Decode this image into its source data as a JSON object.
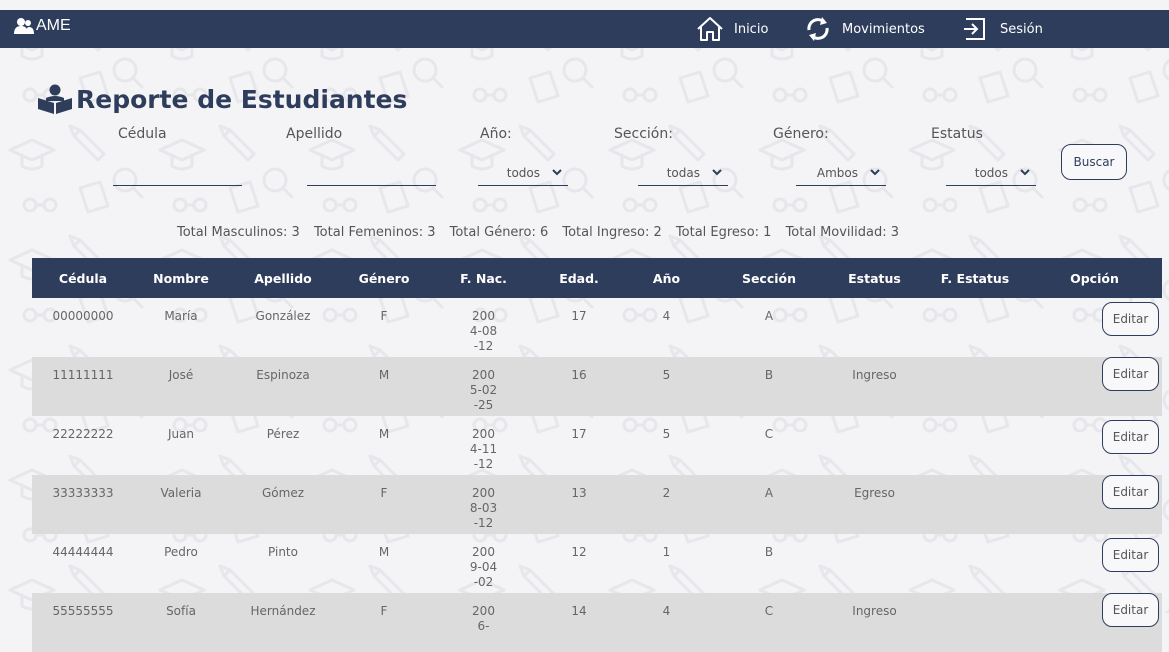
{
  "navbar": {
    "brand": "AME",
    "items": [
      {
        "label": "Inicio",
        "icon": "home-icon"
      },
      {
        "label": "Movimientos",
        "icon": "refresh-icon"
      },
      {
        "label": "Sesión",
        "icon": "logout-icon"
      }
    ]
  },
  "page": {
    "title": "Reporte de Estudiantes",
    "title_icon": "student-reading-icon"
  },
  "filters": {
    "cedula_label": "Cédula",
    "cedula_value": "",
    "apellido_label": "Apellido",
    "apellido_value": "",
    "anio_label": "Año:",
    "anio_value": "todos",
    "seccion_label": "Sección:",
    "seccion_value": "todas",
    "genero_label": "Género:",
    "genero_value": "Ambos",
    "estatus_label": "Estatus",
    "estatus_value": "todos",
    "buscar_label": "Buscar"
  },
  "totals": {
    "masculinos": "Total Masculinos: 3",
    "femeninos": "Total Femeninos: 3",
    "genero": "Total Género: 6",
    "ingreso": "Total Ingreso: 2",
    "egreso": "Total Egreso: 1",
    "movilidad": "Total Movilidad: 3"
  },
  "table": {
    "headers": [
      "Cédula",
      "Nombre",
      "Apellido",
      "Género",
      "F. Nac.",
      "Edad.",
      "Año",
      "Sección",
      "Estatus",
      "F. Estatus",
      "Opción"
    ],
    "edit_label": "Editar",
    "rows": [
      {
        "cedula": "00000000",
        "nombre": "María",
        "apellido": "González",
        "genero": "F",
        "fnac": "2004-08-12",
        "edad": "17",
        "anio": "4",
        "seccion": "A",
        "estatus": "",
        "festatus": ""
      },
      {
        "cedula": "11111111",
        "nombre": "José",
        "apellido": "Espinoza",
        "genero": "M",
        "fnac": "2005-02-25",
        "edad": "16",
        "anio": "5",
        "seccion": "B",
        "estatus": "Ingreso",
        "festatus": ""
      },
      {
        "cedula": "22222222",
        "nombre": "Juan",
        "apellido": "Pérez",
        "genero": "M",
        "fnac": "2004-11-12",
        "edad": "17",
        "anio": "5",
        "seccion": "C",
        "estatus": "",
        "festatus": ""
      },
      {
        "cedula": "33333333",
        "nombre": "Valeria",
        "apellido": "Gómez",
        "genero": "F",
        "fnac": "2008-03-12",
        "edad": "13",
        "anio": "2",
        "seccion": "A",
        "estatus": "Egreso",
        "festatus": ""
      },
      {
        "cedula": "44444444",
        "nombre": "Pedro",
        "apellido": "Pinto",
        "genero": "M",
        "fnac": "2009-04-02",
        "edad": "12",
        "anio": "1",
        "seccion": "B",
        "estatus": "",
        "festatus": ""
      },
      {
        "cedula": "55555555",
        "nombre": "Sofía",
        "apellido": "Hernández",
        "genero": "F",
        "fnac": "2006-",
        "edad": "14",
        "anio": "4",
        "seccion": "C",
        "estatus": "Ingreso",
        "festatus": ""
      }
    ]
  },
  "colors": {
    "primary": "#2e3d5c",
    "background": "#f4f4f6",
    "row_alt": "#dcdcdc",
    "pattern": "#e7e7ec"
  }
}
